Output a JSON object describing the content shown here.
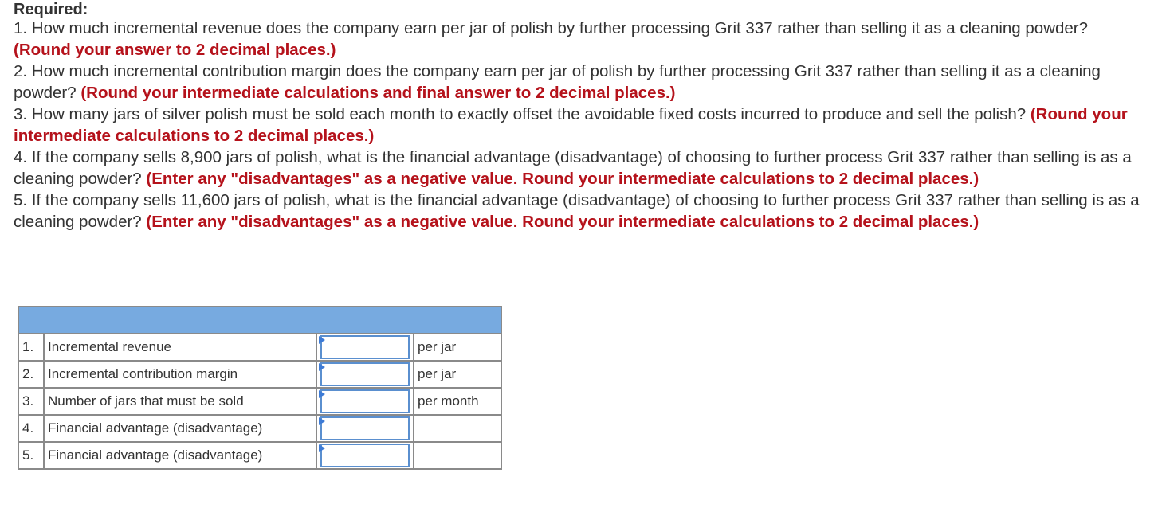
{
  "heading": "Required:",
  "questions": [
    {
      "text": "1. How much incremental revenue does the company earn per jar of polish by further processing Grit 337 rather than selling it as a cleaning powder? ",
      "note": "(Round your answer to 2 decimal places.)"
    },
    {
      "text": "2. How much incremental contribution margin does the company earn per jar of polish by further processing Grit 337 rather than selling it as a cleaning powder? ",
      "note": "(Round your intermediate calculations and final answer to 2 decimal places.)"
    },
    {
      "text": "3. How many jars of silver polish must be sold each month to exactly offset the avoidable fixed costs incurred to produce and sell the polish? ",
      "note": "(Round your intermediate calculations to 2 decimal places.)"
    },
    {
      "text": "4. If the company sells 8,900 jars of polish, what is the financial advantage (disadvantage) of choosing to further process Grit 337 rather than selling is as a cleaning powder? ",
      "note": "(Enter any \"disadvantages\" as a negative value.  Round your intermediate calculations to 2 decimal places.)"
    },
    {
      "text": "5. If the company sells 11,600 jars of polish, what is the financial advantage (disadvantage) of choosing to further process Grit 337 rather than selling is as a cleaning powder? ",
      "note": "(Enter any \"disadvantages\" as a negative value.  Round your intermediate calculations to 2 decimal places.)"
    }
  ],
  "table": {
    "rows": [
      {
        "num": "1.",
        "label": "Incremental revenue",
        "value": "",
        "unit": "per jar"
      },
      {
        "num": "2.",
        "label": "Incremental contribution margin",
        "value": "",
        "unit": "per jar"
      },
      {
        "num": "3.",
        "label": "Number of jars that must be sold",
        "value": "",
        "unit": "per month"
      },
      {
        "num": "4.",
        "label": "Financial advantage (disadvantage)",
        "value": "",
        "unit": ""
      },
      {
        "num": "5.",
        "label": "Financial advantage (disadvantage)",
        "value": "",
        "unit": ""
      }
    ]
  },
  "colors": {
    "accent_red": "#b5121b",
    "header_blue": "#77aae0",
    "input_border": "#5a8fcf"
  }
}
